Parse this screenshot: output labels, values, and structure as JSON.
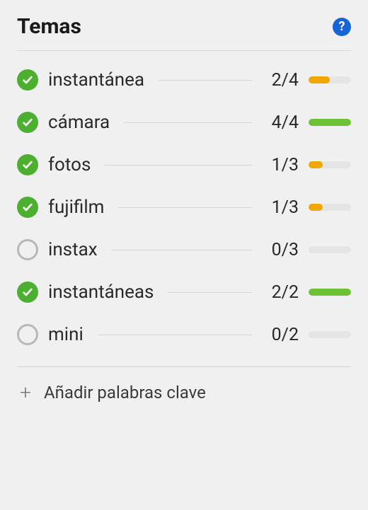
{
  "title": "Temas",
  "help_glyph": "?",
  "colors": {
    "green": "#6cc234",
    "orange": "#f0a800",
    "empty": "#e5e5e5"
  },
  "items": [
    {
      "checked": true,
      "label": "instantánea",
      "current": 2,
      "target": 4
    },
    {
      "checked": true,
      "label": "cámara",
      "current": 4,
      "target": 4
    },
    {
      "checked": true,
      "label": "fotos",
      "current": 1,
      "target": 3
    },
    {
      "checked": true,
      "label": "fujifilm",
      "current": 1,
      "target": 3
    },
    {
      "checked": false,
      "label": "instax",
      "current": 0,
      "target": 3
    },
    {
      "checked": true,
      "label": "instantáneas",
      "current": 2,
      "target": 2
    },
    {
      "checked": false,
      "label": "mini",
      "current": 0,
      "target": 2
    }
  ],
  "footer": {
    "plus_glyph": "+",
    "add_label": "Añadir palabras clave"
  }
}
